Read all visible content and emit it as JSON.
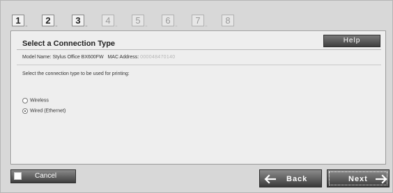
{
  "steps": [
    {
      "number": "1",
      "active": true
    },
    {
      "number": "2",
      "active": true
    },
    {
      "number": "3",
      "active": true
    },
    {
      "number": "4",
      "active": false
    },
    {
      "number": "5",
      "active": false
    },
    {
      "number": "6",
      "active": false
    },
    {
      "number": "7",
      "active": false
    },
    {
      "number": "8",
      "active": false
    }
  ],
  "step_dots": "...",
  "panel": {
    "title": "Select a Connection Type",
    "help_label": "Help",
    "model_label": "Model Name: Stylus Office BX600FW",
    "mac_label": "MAC Address:",
    "mac_value": "000048470140",
    "prompt": "Select the connection type to be used for printing:",
    "options": [
      {
        "label": "Wireless",
        "checked": false
      },
      {
        "label": "Wired (Ethernet)",
        "checked": true
      }
    ]
  },
  "footer": {
    "cancel_label": "Cancel",
    "back_label": "Back",
    "next_label": "Next"
  }
}
